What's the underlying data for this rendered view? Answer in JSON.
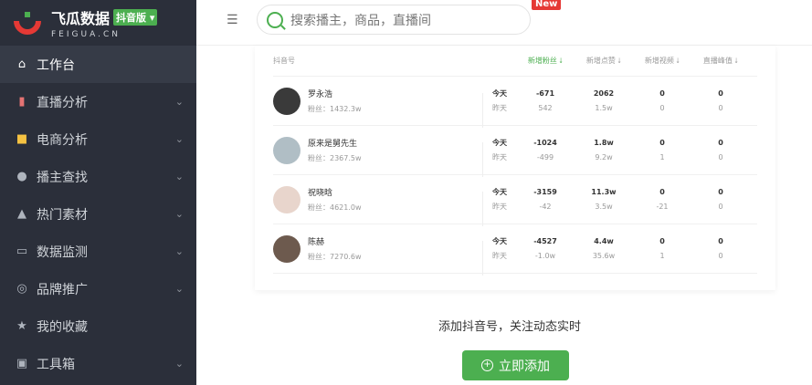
{
  "brand": {
    "name": "飞瓜数据",
    "badge": "抖音版",
    "sub": "FEIGUA.CN"
  },
  "search": {
    "placeholder": "搜索播主，商品，直播间",
    "new_label": "New"
  },
  "nav": [
    {
      "label": "工作台",
      "icon": "home-icon",
      "active": true
    },
    {
      "label": "直播分析",
      "icon": "bar-chart-icon"
    },
    {
      "label": "电商分析",
      "icon": "bag-icon"
    },
    {
      "label": "播主查找",
      "icon": "search-icon"
    },
    {
      "label": "热门素材",
      "icon": "fire-icon"
    },
    {
      "label": "数据监测",
      "icon": "monitor-icon"
    },
    {
      "label": "品牌推广",
      "icon": "brand-icon"
    },
    {
      "label": "我的收藏",
      "icon": "star-icon"
    },
    {
      "label": "工具箱",
      "icon": "toolbox-icon"
    }
  ],
  "table": {
    "headers": {
      "name": "抖音号",
      "c1": "新增粉丝",
      "c2": "新增点赞",
      "c3": "新增视频",
      "c4": "直播峰值"
    },
    "today_label": "今天",
    "yesterday_label": "昨天",
    "rows": [
      {
        "name": "罗永浩",
        "fans": "粉丝：1432.3w",
        "t": [
          "-671",
          "2062",
          "0",
          "0"
        ],
        "y": [
          "542",
          "1.5w",
          "0",
          "0"
        ]
      },
      {
        "name": "原来是舅先生",
        "fans": "粉丝：2367.5w",
        "t": [
          "-1024",
          "1.8w",
          "0",
          "0"
        ],
        "y": [
          "-499",
          "9.2w",
          "1",
          "0"
        ]
      },
      {
        "name": "祝晓晗",
        "fans": "粉丝：4621.0w",
        "t": [
          "-3159",
          "11.3w",
          "0",
          "0"
        ],
        "y": [
          "-42",
          "3.5w",
          "-21",
          "0"
        ]
      },
      {
        "name": "陈赫",
        "fans": "粉丝：7270.6w",
        "t": [
          "-4527",
          "4.4w",
          "0",
          "0"
        ],
        "y": [
          "-1.0w",
          "35.6w",
          "1",
          "0"
        ]
      }
    ]
  },
  "cta": {
    "text": "添加抖音号，关注动态实时",
    "button": "立即添加"
  }
}
